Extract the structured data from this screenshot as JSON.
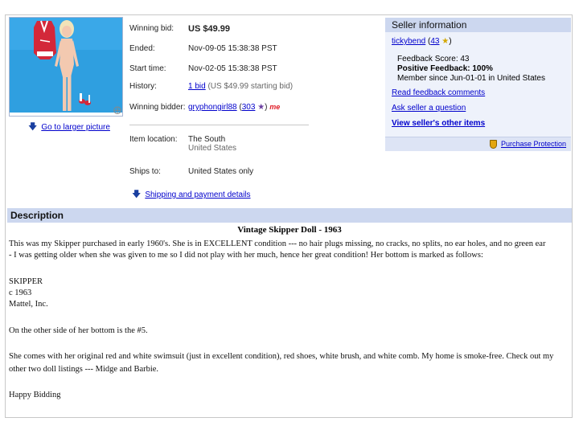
{
  "item": {
    "photo_alt_icon": "doll-photo",
    "larger_picture_link": "Go to larger picture"
  },
  "details": {
    "winning_bid_label": "Winning bid:",
    "winning_bid_value": "US $49.99",
    "ended_label": "Ended:",
    "ended_value": "Nov-09-05 15:38:38 PST",
    "start_label": "Start time:",
    "start_value": "Nov-02-05 15:38:38 PST",
    "history_label": "History:",
    "history_bids": "1 bid",
    "history_note": "(US $49.99 starting bid)",
    "bidder_label": "Winning bidder:",
    "bidder_name": "gryphongirl88",
    "bidder_score": "303",
    "bidder_me_badge": "me",
    "location_label": "Item location:",
    "location_line1": "The South",
    "location_line2": "United States",
    "ships_label": "Ships to:",
    "ships_value": "United States only",
    "shipping_link": "Shipping and payment details"
  },
  "seller": {
    "header": "Seller information",
    "name": "tickybend",
    "score": "43",
    "feedback_score_line": "Feedback Score: 43",
    "positive_line": "Positive Feedback: 100%",
    "member_since": "Member since Jun-01-01 in United States",
    "read_feedback": "Read feedback comments",
    "ask_question": "Ask seller a question",
    "other_items": "View seller's other items",
    "protection": "Purchase Protection"
  },
  "description": {
    "header": "Description",
    "title": "Vintage Skipper Doll - 1963",
    "para1_line1": "This was my Skipper purchased in early 1960's. She is in EXCELLENT condition --- no hair plugs missing, no cracks, no splits, no ear holes, and no green ear",
    "para1_line2": "- I was getting older when she was given to me so I did not play with her much, hence her great condition! Her bottom is marked as follows:",
    "marking1": "SKIPPER",
    "marking2": "c 1963",
    "marking3": "Mattel, Inc.",
    "other_side": "On the other side of her bottom is the #5.",
    "para2_line1": "She comes with her original red and white swimsuit (just in excellent condition), red shoes, white brush, and white comb. My home is smoke-free. Check out my",
    "para2_line2": "other two doll listings --- Midge and Barbie.",
    "signoff": "Happy Bidding"
  },
  "colors": {
    "header_bg": "#ccd7ef",
    "seller_bg": "#eef2fb",
    "link": "#0000cc"
  }
}
